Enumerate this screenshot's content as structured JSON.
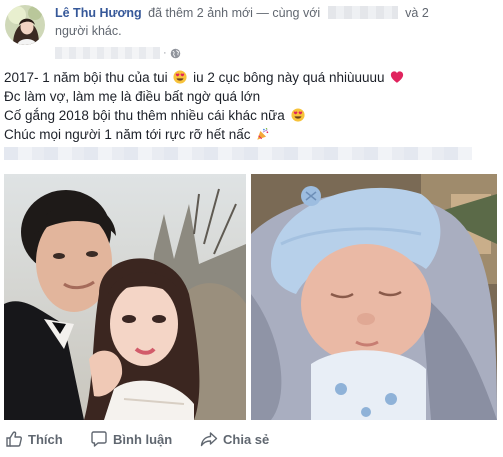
{
  "post": {
    "author": "Lê Thu Hương",
    "action_text": "đã thêm 2 ảnh mới — cùng với",
    "and_text": "và 2",
    "others_text": "người khác.",
    "dot": "·",
    "lines": [
      "2017- 1 năm bội thu của tui",
      "iu 2 cục bông này quá nhiùuuuu",
      "Đc làm vợ, làm mẹ là điều bất ngờ quá lớn",
      "Cố gắng 2018 bội thu thêm nhiều cái khác nữa",
      "Chúc mọi người 1 năm tới rực rỡ hết nấc"
    ]
  },
  "actions": {
    "like": "Thích",
    "comment": "Bình luận",
    "share": "Chia sẻ"
  },
  "icons": {
    "globe": "globe-icon",
    "heart_eyes": "heart-eyes-emoji-icon",
    "heart": "red-heart-emoji-icon",
    "party": "party-popper-emoji-icon",
    "like": "thumbs-up-icon",
    "comment": "comment-bubble-icon",
    "share": "share-arrow-icon"
  },
  "colors": {
    "author": "#365899",
    "text": "#1d2129",
    "secondary": "#616770",
    "action": "#606770"
  }
}
